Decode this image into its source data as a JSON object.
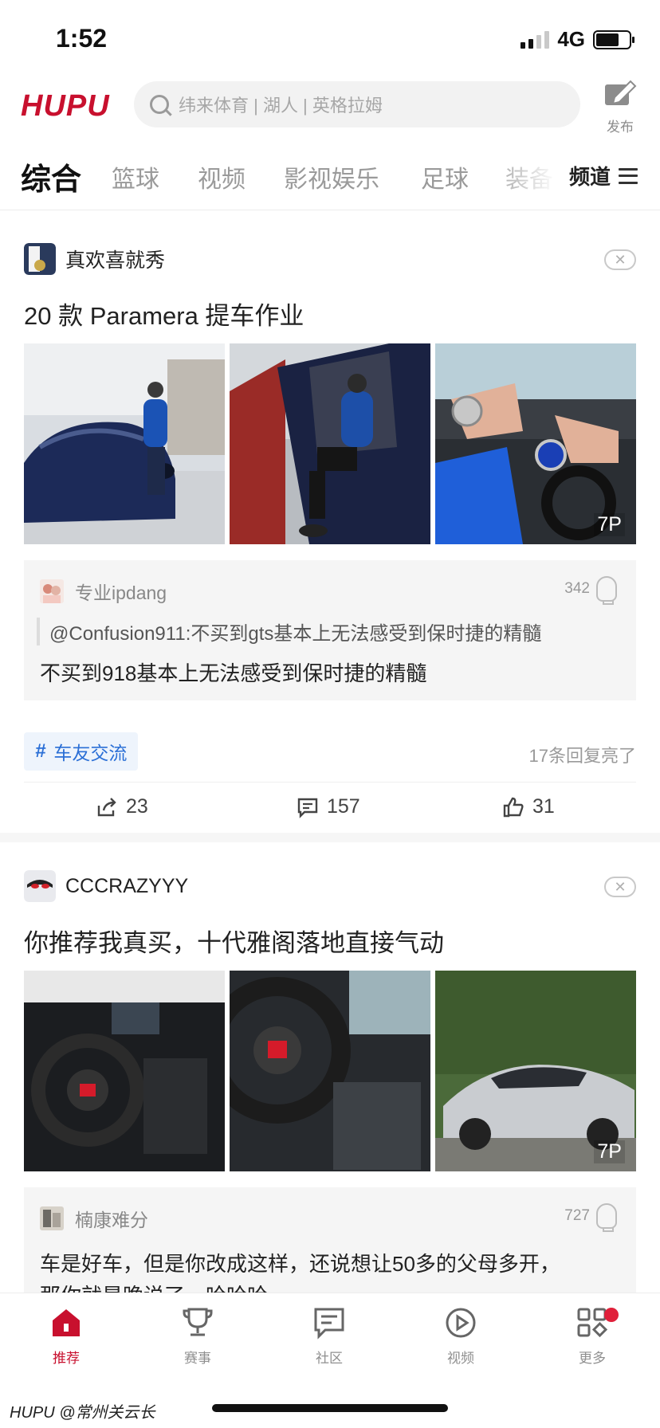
{
  "status_bar": {
    "time": "1:52",
    "network": "4G"
  },
  "header": {
    "logo": "HUPU",
    "search_placeholder": "纬来体育 | 湖人 | 英格拉姆",
    "publish_label": "发布"
  },
  "tabs": {
    "items": [
      {
        "label": "综合"
      },
      {
        "label": "篮球"
      },
      {
        "label": "视频"
      },
      {
        "label": "影视娱乐"
      },
      {
        "label": "足球"
      },
      {
        "label": "装备"
      }
    ],
    "active_index": 0,
    "channel_label": "频道"
  },
  "feed": [
    {
      "author": "真欢喜就秀",
      "title": "20 款 Paramera 提车作业",
      "image_count_label": "7P",
      "top_comment": {
        "user": "专业ipdang",
        "likes": "342",
        "quote": "@Confusion911:不买到gts基本上无法感受到保时捷的精髓",
        "text": "不买到918基本上无法感受到保时捷的精髓"
      },
      "tag": "车友交流",
      "reply_info": "17条回复亮了",
      "shares": "23",
      "comments": "157",
      "likes": "31"
    },
    {
      "author": "CCCRAZYYY",
      "title": "你推荐我真买，十代雅阁落地直接气动",
      "image_count_label": "7P",
      "top_comment": {
        "user": "楠康难分",
        "likes": "727",
        "text": "车是好车，但是你改成这样，还说想让50多的父母多开，",
        "text_line2": "那你就是晚说了，哈哈哈"
      }
    }
  ],
  "bottom_nav": [
    {
      "label": "推荐"
    },
    {
      "label": "赛事"
    },
    {
      "label": "社区"
    },
    {
      "label": "视频"
    },
    {
      "label": "更多"
    }
  ],
  "watermark": "HUPU @常州关云长",
  "colors": {
    "brand": "#c8102e",
    "link": "#2b6fd6",
    "muted": "#9a9a9a"
  }
}
